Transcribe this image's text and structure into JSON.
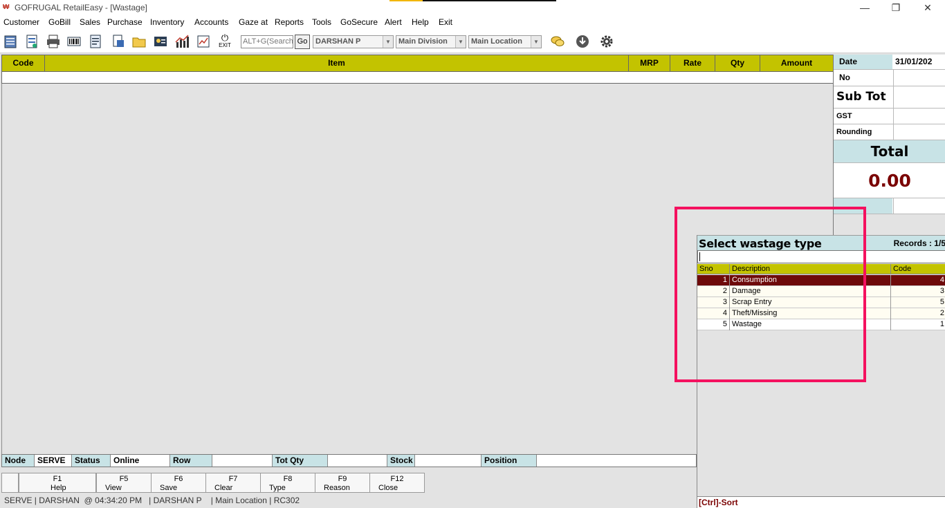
{
  "window": {
    "title": "GOFRUGAL RetailEasy - [Wastage]",
    "controls": [
      "—",
      "❐",
      "✕"
    ]
  },
  "menu": [
    "Customer",
    "GoBill",
    "Sales",
    "Purchase",
    "Inventory",
    "Accounts",
    "Gaze at",
    "Reports",
    "Tools",
    "GoSecure",
    "Alert",
    "Help",
    "Exit"
  ],
  "toolbar": {
    "exit_label": "EXIT",
    "search_placeholder": "ALT+G(Search",
    "go_label": "Go",
    "user": "DARSHAN P",
    "division": "Main Division",
    "location": "Main Location"
  },
  "grid": {
    "columns": [
      "Code",
      "Item",
      "MRP",
      "Rate",
      "Qty",
      "Amount"
    ]
  },
  "summary": {
    "date_label": "Date",
    "date_value": "31/01/202",
    "no_label": "No",
    "subtot_label": "Sub Tot",
    "gst_label": "GST",
    "rounding_label": "Rounding",
    "total_label": "Total",
    "total_value": "0.00",
    "colors": {
      "total_value": "#7a0000",
      "label_bg": "#c8e3e6"
    }
  },
  "popup": {
    "title": "Select wastage type",
    "records": "Records : 1/5",
    "columns": [
      "Sno",
      "Description",
      "Code"
    ],
    "rows": [
      {
        "sno": "1",
        "description": "Consumption",
        "code": "4"
      },
      {
        "sno": "2",
        "description": "Damage",
        "code": "3"
      },
      {
        "sno": "3",
        "description": "Scrap Entry",
        "code": "5"
      },
      {
        "sno": "4",
        "description": "Theft/Missing",
        "code": "2"
      },
      {
        "sno": "5",
        "description": "Wastage",
        "code": "1"
      }
    ],
    "footer": "[Ctrl]-Sort"
  },
  "status": {
    "node_label": "Node",
    "node_value": "SERVE",
    "status_label": "Status",
    "status_value": "Online",
    "row_label": "Row",
    "totqty_label": "Tot Qty",
    "stock_label": "Stock",
    "position_label": "Position"
  },
  "fkeys": [
    {
      "key": "F1",
      "label": "Help"
    },
    {
      "key": "F5",
      "label": "View"
    },
    {
      "key": "F6",
      "label": "Save"
    },
    {
      "key": "F7",
      "label": "Clear"
    },
    {
      "key": "F8",
      "label": "Type"
    },
    {
      "key": "F9",
      "label": "Reason"
    },
    {
      "key": "F12",
      "label": "Close"
    }
  ],
  "bottom_status": "SERVE | DARSHAN  @ 04:34:20 PM   | DARSHAN P    | Main Location | RC302",
  "colors": {
    "grid_header": "#c3c300",
    "selected_row": "#6e0a0a",
    "highlight": "#f4115f"
  }
}
